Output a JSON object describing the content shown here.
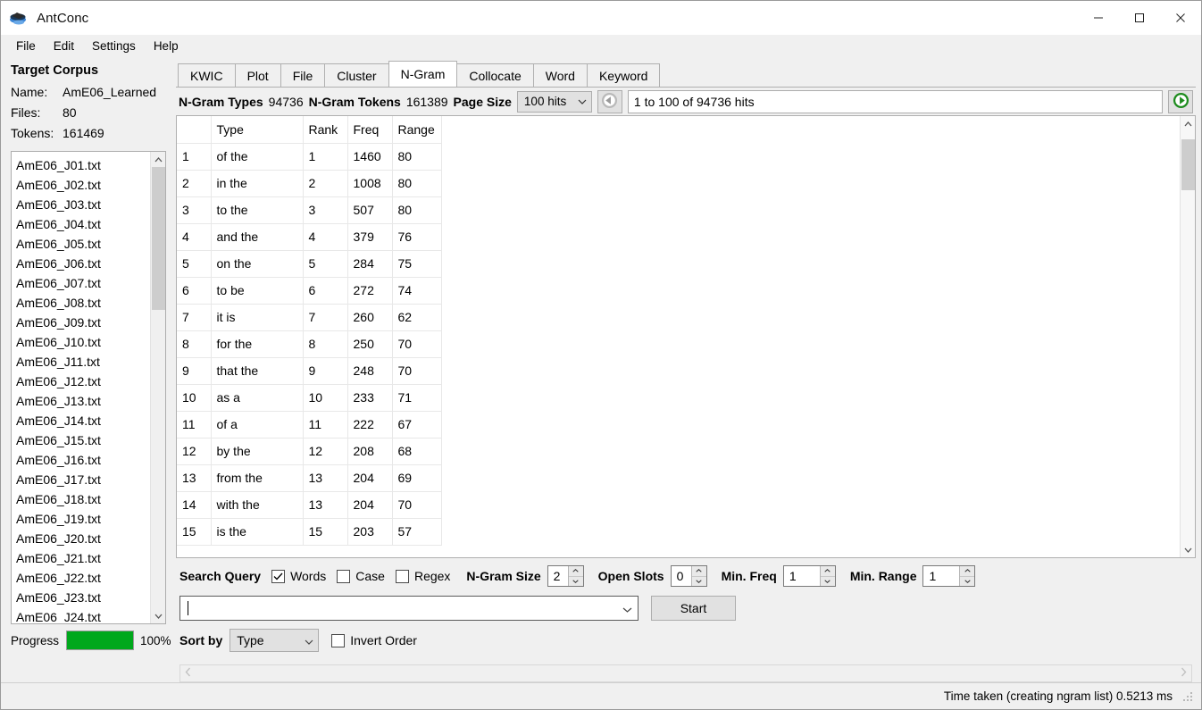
{
  "window": {
    "title": "AntConc",
    "icon": "antconc-logo-icon",
    "minimize": "─",
    "maximize": "☐",
    "close": "✕"
  },
  "menubar": {
    "items": [
      "File",
      "Edit",
      "Settings",
      "Help"
    ]
  },
  "sidebar": {
    "title": "Target Corpus",
    "name_label": "Name:",
    "name_value": "AmE06_Learned",
    "files_label": "Files:",
    "files_value": "80",
    "tokens_label": "Tokens:",
    "tokens_value": "161469",
    "files": [
      "AmE06_J01.txt",
      "AmE06_J02.txt",
      "AmE06_J03.txt",
      "AmE06_J04.txt",
      "AmE06_J05.txt",
      "AmE06_J06.txt",
      "AmE06_J07.txt",
      "AmE06_J08.txt",
      "AmE06_J09.txt",
      "AmE06_J10.txt",
      "AmE06_J11.txt",
      "AmE06_J12.txt",
      "AmE06_J13.txt",
      "AmE06_J14.txt",
      "AmE06_J15.txt",
      "AmE06_J16.txt",
      "AmE06_J17.txt",
      "AmE06_J18.txt",
      "AmE06_J19.txt",
      "AmE06_J20.txt",
      "AmE06_J21.txt",
      "AmE06_J22.txt",
      "AmE06_J23.txt",
      "AmE06_J24.txt"
    ],
    "progress_label": "Progress",
    "progress_percent": "100%",
    "progress_value": 100,
    "progress_color": "#00a81c"
  },
  "tabs": [
    {
      "label": "KWIC",
      "active": false
    },
    {
      "label": "Plot",
      "active": false
    },
    {
      "label": "File",
      "active": false
    },
    {
      "label": "Cluster",
      "active": false
    },
    {
      "label": "N-Gram",
      "active": true
    },
    {
      "label": "Collocate",
      "active": false
    },
    {
      "label": "Word",
      "active": false
    },
    {
      "label": "Keyword",
      "active": false
    }
  ],
  "toolbar": {
    "types_label": "N-Gram Types",
    "types_value": "94736",
    "tokens_label": "N-Gram Tokens",
    "tokens_value": "161389",
    "page_size_label": "Page Size",
    "page_size_value": "100 hits",
    "prev_icon": "arrow-left-circle-icon",
    "next_icon": "arrow-right-circle-icon",
    "hits_range": "1 to 100 of 94736 hits"
  },
  "table": {
    "columns": [
      "",
      "Type",
      "Rank",
      "Freq",
      "Range"
    ],
    "rows": [
      {
        "index": "1",
        "type": "of the",
        "rank": "1",
        "freq": "1460",
        "range": "80"
      },
      {
        "index": "2",
        "type": "in the",
        "rank": "2",
        "freq": "1008",
        "range": "80"
      },
      {
        "index": "3",
        "type": "to the",
        "rank": "3",
        "freq": "507",
        "range": "80"
      },
      {
        "index": "4",
        "type": "and the",
        "rank": "4",
        "freq": "379",
        "range": "76"
      },
      {
        "index": "5",
        "type": "on the",
        "rank": "5",
        "freq": "284",
        "range": "75"
      },
      {
        "index": "6",
        "type": "to be",
        "rank": "6",
        "freq": "272",
        "range": "74"
      },
      {
        "index": "7",
        "type": "it is",
        "rank": "7",
        "freq": "260",
        "range": "62"
      },
      {
        "index": "8",
        "type": "for the",
        "rank": "8",
        "freq": "250",
        "range": "70"
      },
      {
        "index": "9",
        "type": "that the",
        "rank": "9",
        "freq": "248",
        "range": "70"
      },
      {
        "index": "10",
        "type": "as a",
        "rank": "10",
        "freq": "233",
        "range": "71"
      },
      {
        "index": "11",
        "type": "of a",
        "rank": "11",
        "freq": "222",
        "range": "67"
      },
      {
        "index": "12",
        "type": "by the",
        "rank": "12",
        "freq": "208",
        "range": "68"
      },
      {
        "index": "13",
        "type": "from the",
        "rank": "13",
        "freq": "204",
        "range": "69"
      },
      {
        "index": "14",
        "type": "with the",
        "rank": "13",
        "freq": "204",
        "range": "70"
      },
      {
        "index": "15",
        "type": "is the",
        "rank": "15",
        "freq": "203",
        "range": "57"
      }
    ]
  },
  "controls": {
    "search_query_label": "Search Query",
    "words_label": "Words",
    "words_checked": true,
    "case_label": "Case",
    "case_checked": false,
    "regex_label": "Regex",
    "regex_checked": false,
    "ngram_size_label": "N-Gram Size",
    "ngram_size_value": "2",
    "open_slots_label": "Open Slots",
    "open_slots_value": "0",
    "min_freq_label": "Min. Freq",
    "min_freq_value": "1",
    "min_range_label": "Min. Range",
    "min_range_value": "1",
    "query_value": "",
    "query_placeholder": "",
    "start_label": "Start",
    "sort_by_label": "Sort by",
    "sort_by_value": "Type",
    "invert_order_label": "Invert Order",
    "invert_order_checked": false
  },
  "statusbar": {
    "message": "Time taken (creating ngram list) 0.5213 ms"
  }
}
